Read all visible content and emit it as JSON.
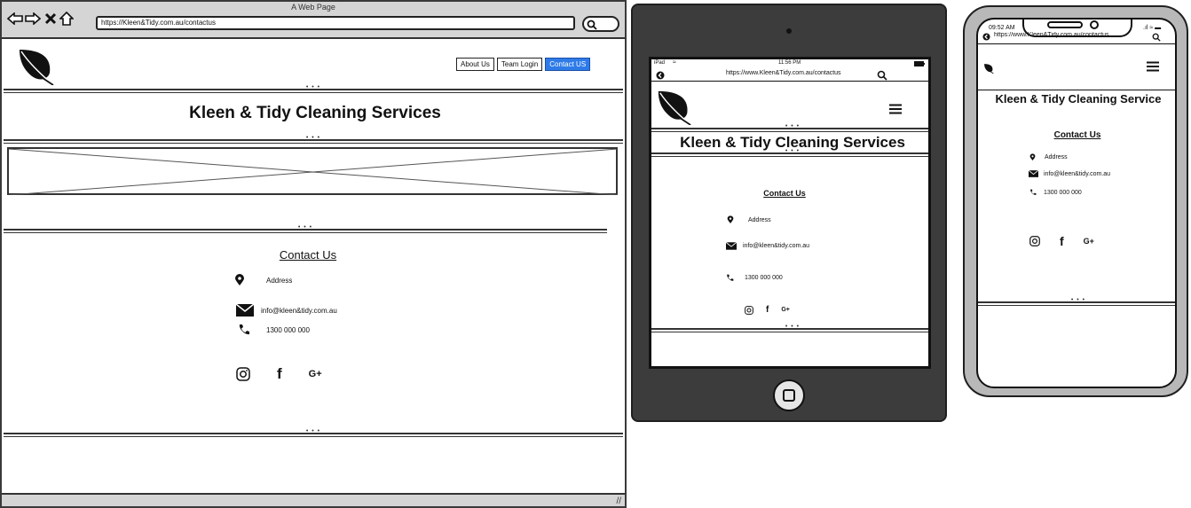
{
  "desktop": {
    "window_title": "A Web Page",
    "url": "https://Kleen&Tidy.com.au/contactus",
    "nav": [
      {
        "label": "About Us",
        "active": false
      },
      {
        "label": "Team Login",
        "active": false
      },
      {
        "label": "Contact US",
        "active": true
      }
    ],
    "hero_title": "Kleen & Tidy Cleaning Services",
    "contact": {
      "heading": "Contact Us",
      "address": "Address",
      "email": "info@kleen&tidy.com.au",
      "phone": "1300 000 000"
    },
    "social": {
      "instagram": "instagram-icon",
      "facebook": "f",
      "google_plus": "G+"
    }
  },
  "ipad": {
    "status_left": "iPad",
    "status_time": "11:56 PM",
    "url": "https://www.Kleen&Tidy.com.au/contactus",
    "hero_title": "Kleen & Tidy Cleaning Services",
    "contact": {
      "heading": "Contact Us",
      "address": "Address",
      "email": "info@kleen&tidy.com.au",
      "phone": "1300 000 000"
    },
    "social": {
      "facebook": "f",
      "google_plus": "G+"
    }
  },
  "iphone": {
    "status_time": "09:52 AM",
    "url": "https://www.Kleen&Tidy.com.au/contactus",
    "hero_title": "Kleen & Tidy Cleaning Service",
    "contact": {
      "heading": "Contact Us",
      "address": "Address",
      "email": "info@kleen&tidy.com.au",
      "phone": "1300 000 000"
    },
    "social": {
      "facebook": "f",
      "google_plus": "G+"
    }
  },
  "colors": {
    "accent": "#2e7be8",
    "frame_dark": "#3c3c3c",
    "phone_frame": "#b8b8b8"
  }
}
